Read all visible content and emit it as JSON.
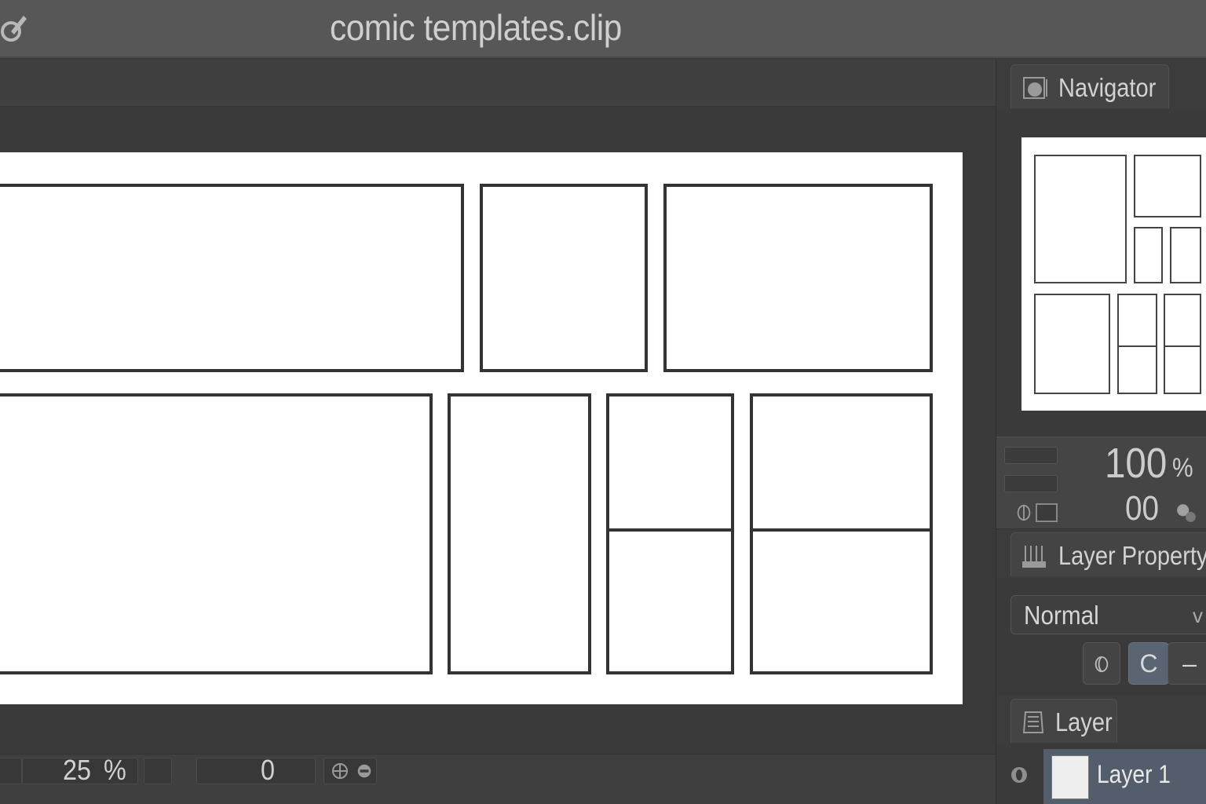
{
  "window": {
    "title": "comic templates.clip"
  },
  "statusbar": {
    "zoom_value": "25",
    "zoom_unit": "%",
    "rotation_value": "0"
  },
  "navigator": {
    "tab_label": "Navigator"
  },
  "zoom_box": {
    "zoom_value": "100",
    "zoom_unit": "%",
    "rotation_value": "00"
  },
  "layer_property": {
    "tab_label": "Layer Property",
    "blend_mode": "Normal",
    "buttons": [
      "C",
      "–"
    ]
  },
  "layer_panel": {
    "tab_label": "Layer",
    "layers": [
      {
        "name": "Layer 1"
      }
    ]
  },
  "colors": {
    "titlebar": "#575757",
    "canvas_bg": "#3a3a3a",
    "page": "#ffffff",
    "panel_border": "#333333",
    "selected_layer": "#545d6b",
    "active_button": "#5a6472"
  }
}
